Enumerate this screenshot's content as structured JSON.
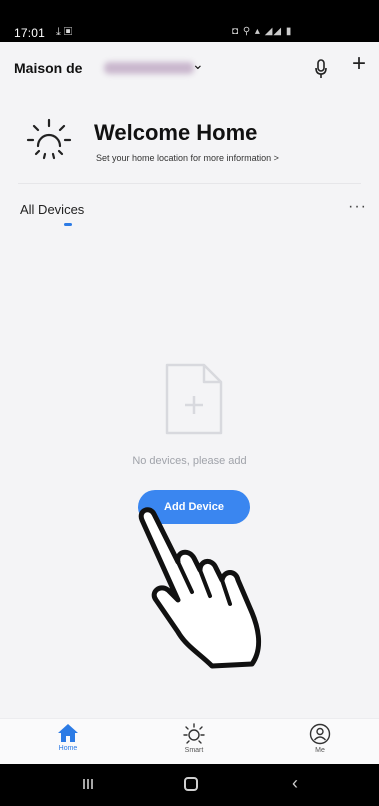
{
  "status_bar": {
    "time": "17:01",
    "left_icons": "⤓ ▣",
    "right_icons": "◘ ⚲ ▴ ◢◢ ▮"
  },
  "header": {
    "home_prefix": "Maison de",
    "chevron": "⌄",
    "add_symbol": "+"
  },
  "welcome": {
    "title": "Welcome Home",
    "subtitle": "Set your home location for more information >"
  },
  "devices": {
    "tab_label": "All Devices",
    "more_symbol": "···",
    "empty_text": "No devices, please add",
    "add_button": "Add Device"
  },
  "tabbar": {
    "items": [
      {
        "label": "Home",
        "icon": "home-icon",
        "active": true
      },
      {
        "label": "Smart",
        "icon": "sun-icon",
        "active": false
      },
      {
        "label": "Me",
        "icon": "person-icon",
        "active": false
      }
    ]
  },
  "colors": {
    "accent": "#2c7be5",
    "button": "#3a86f0",
    "background": "#f4f4f6"
  }
}
